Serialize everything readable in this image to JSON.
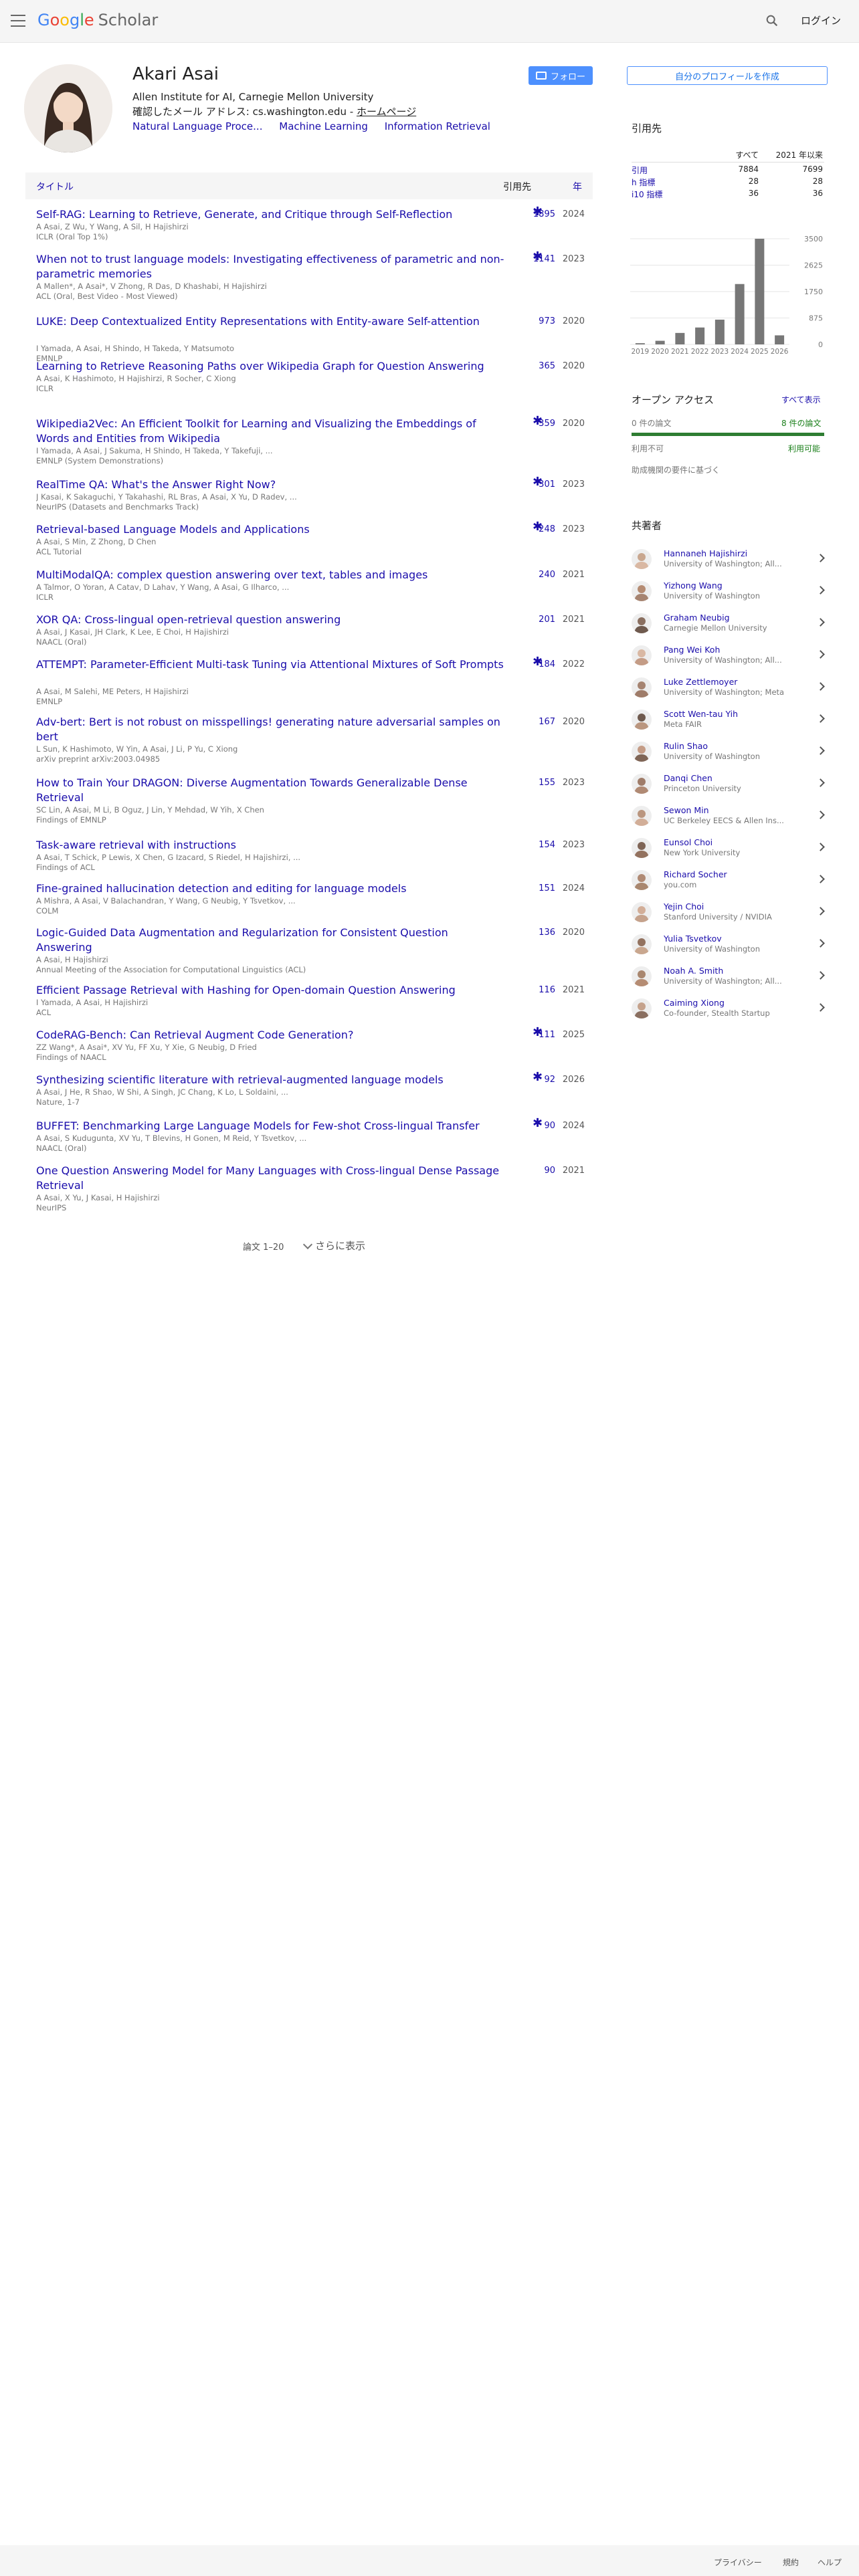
{
  "header": {
    "logo_google": [
      "G",
      "o",
      "o",
      "g",
      "l",
      "e"
    ],
    "logo_scholar": "Scholar",
    "login": "ログイン"
  },
  "profile": {
    "name": "Akari Asai",
    "affiliation": "Allen Institute for AI, Carnegie Mellon University",
    "email_text": "確認したメール アドレス: cs.washington.edu - ",
    "homepage": "ホームページ",
    "interests": [
      "Natural Language Proce...",
      "Machine Learning",
      "Information Retrieval"
    ],
    "follow": "フォロー"
  },
  "table": {
    "col_title": "タイトル",
    "col_cites": "引用先",
    "col_year": "年"
  },
  "publications": [
    {
      "title": "Self-RAG: Learning to Retrieve, Generate, and Critique through Self-Reflection",
      "authors": "A Asai, Z Wu, Y Wang, A Sil, H Hajishirzi",
      "venue": "ICLR (Oral Top 1%)",
      "cites": "1895",
      "star": true,
      "year": "2024"
    },
    {
      "title": "When not to trust language models: Investigating effectiveness of parametric and non-parametric memories",
      "authors": "A Mallen*, A Asai*, V Zhong, R Das, D Khashabi, H Hajishirzi",
      "venue": "ACL (Oral, Best Video - Most Viewed)",
      "cites": "1141",
      "star": true,
      "year": "2023"
    },
    {
      "title": "LUKE: Deep Contextualized Entity Representations with Entity-aware Self-attention",
      "authors": "I Yamada, A Asai, H Shindo, H Takeda, Y Matsumoto",
      "venue": "EMNLP",
      "cites": "973",
      "star": false,
      "year": "2020"
    },
    {
      "title": "Learning to Retrieve Reasoning Paths over Wikipedia Graph for Question Answering",
      "authors": "A Asai, K Hashimoto, H Hajishirzi, R Socher, C Xiong",
      "venue": "ICLR",
      "cites": "365",
      "star": false,
      "year": "2020"
    },
    {
      "title": "Wikipedia2Vec: An Efficient Toolkit for Learning and Visualizing the Embeddings of Words and Entities from Wikipedia",
      "authors": "I Yamada, A Asai, J Sakuma, H Shindo, H Takeda, Y Takefuji, ...",
      "venue": "EMNLP (System Demonstrations)",
      "cites": "359",
      "star": true,
      "year": "2020"
    },
    {
      "title": "RealTime QA: What's the Answer Right Now?",
      "authors": "J Kasai, K Sakaguchi, Y Takahashi, RL Bras, A Asai, X Yu, D Radev, ...",
      "venue": "NeurIPS (Datasets and Benchmarks Track)",
      "cites": "301",
      "star": true,
      "year": "2023"
    },
    {
      "title": "Retrieval-based Language Models and Applications",
      "authors": "A Asai, S Min, Z Zhong, D Chen",
      "venue": "ACL Tutorial",
      "cites": "248",
      "star": true,
      "year": "2023"
    },
    {
      "title": "MultiModalQA: complex question answering over text, tables and images",
      "authors": "A Talmor, O Yoran, A Catav, D Lahav, Y Wang, A Asai, G Ilharco, ...",
      "venue": "ICLR",
      "cites": "240",
      "star": false,
      "year": "2021"
    },
    {
      "title": "XOR QA: Cross-lingual open-retrieval question answering",
      "authors": "A Asai, J Kasai, JH Clark, K Lee, E Choi, H Hajishirzi",
      "venue": "NAACL (Oral)",
      "cites": "201",
      "star": false,
      "year": "2021"
    },
    {
      "title": "ATTEMPT: Parameter-Efficient Multi-task Tuning via Attentional Mixtures of Soft Prompts",
      "authors": "A Asai, M Salehi, ME Peters, H Hajishirzi",
      "venue": "EMNLP",
      "cites": "184",
      "star": true,
      "year": "2022"
    },
    {
      "title": "Adv-bert: Bert is not robust on misspellings! generating nature adversarial samples on bert",
      "authors": "L Sun, K Hashimoto, W Yin, A Asai, J Li, P Yu, C Xiong",
      "venue": "arXiv preprint arXiv:2003.04985",
      "cites": "167",
      "star": false,
      "year": "2020"
    },
    {
      "title": "How to Train Your DRAGON: Diverse Augmentation Towards Generalizable Dense Retrieval",
      "authors": "SC Lin, A Asai, M Li, B Oguz, J Lin, Y Mehdad, W Yih, X Chen",
      "venue": "Findings of EMNLP",
      "cites": "155",
      "star": false,
      "year": "2023"
    },
    {
      "title": "Task-aware retrieval with instructions",
      "authors": "A Asai, T Schick, P Lewis, X Chen, G Izacard, S Riedel, H Hajishirzi, ...",
      "venue": "Findings of ACL",
      "cites": "154",
      "star": false,
      "year": "2023"
    },
    {
      "title": "Fine-grained hallucination detection and editing for language models",
      "authors": "A Mishra, A Asai, V Balachandran, Y Wang, G Neubig, Y Tsvetkov, ...",
      "venue": "COLM",
      "cites": "151",
      "star": false,
      "year": "2024"
    },
    {
      "title": "Logic-Guided Data Augmentation and Regularization for Consistent Question Answering",
      "authors": "A Asai, H Hajishirzi",
      "venue": "Annual Meeting of the Association for Computational Linguistics (ACL)",
      "cites": "136",
      "star": false,
      "year": "2020"
    },
    {
      "title": "Efficient Passage Retrieval with Hashing for Open-domain Question Answering",
      "authors": "I Yamada, A Asai, H Hajishirzi",
      "venue": "ACL",
      "cites": "116",
      "star": false,
      "year": "2021"
    },
    {
      "title": "CodeRAG-Bench: Can Retrieval Augment Code Generation?",
      "authors": "ZZ Wang*, A Asai*, XV Yu, FF Xu, Y Xie, G Neubig, D Fried",
      "venue": "Findings of NAACL",
      "cites": "111",
      "star": true,
      "year": "2025"
    },
    {
      "title": "Synthesizing scientific literature with retrieval-augmented language models",
      "authors": "A Asai, J He, R Shao, W Shi, A Singh, JC Chang, K Lo, L Soldaini, ...",
      "venue": "Nature, 1-7",
      "cites": "92",
      "star": true,
      "year": "2026"
    },
    {
      "title": "BUFFET: Benchmarking Large Language Models for Few-shot Cross-lingual Transfer",
      "authors": "A Asai, S Kudugunta, XV Yu, T Blevins, H Gonen, M Reid, Y Tsvetkov, ...",
      "venue": "NAACL (Oral)",
      "cites": "90",
      "star": true,
      "year": "2024"
    },
    {
      "title": "One Question Answering Model for Many Languages with Cross-lingual Dense Passage Retrieval",
      "authors": "A Asai, X Yu, J Kasai, H Hajishirzi",
      "venue": "NeurIPS",
      "cites": "90",
      "star": false,
      "year": "2021"
    }
  ],
  "pagination": {
    "range": "論文 1–20",
    "show_more": "さらに表示"
  },
  "sidebar": {
    "create_profile": "自分のプロフィールを作成",
    "cited_by": "引用先",
    "col_all": "すべて",
    "col_since": "2021 年以来",
    "metrics": [
      {
        "label": "引用",
        "all": "7884",
        "since": "7699"
      },
      {
        "label": "h 指標",
        "all": "28",
        "since": "28"
      },
      {
        "label": "i10 指標",
        "all": "36",
        "since": "36"
      }
    ],
    "open_access_title": "オープン アクセス",
    "show_all": "すべて表示",
    "oa_left": "0 件の論文",
    "oa_right": "8 件の論文",
    "not_available": "利用不可",
    "available": "利用可能",
    "mandate_note": "助成機関の要件に基づく",
    "coauthors_title": "共著者"
  },
  "chart_data": {
    "type": "bar",
    "categories": [
      "2019",
      "2020",
      "2021",
      "2022",
      "2023",
      "2024",
      "2025",
      "2026"
    ],
    "values": [
      40,
      120,
      380,
      560,
      820,
      2000,
      3500,
      300
    ],
    "yticks": [
      "3500",
      "2625",
      "1750",
      "875",
      "0"
    ],
    "ylim": [
      0,
      3500
    ],
    "bar_color": "#777777"
  },
  "coauthors": [
    {
      "name": "Hannaneh Hajishirzi",
      "affiliation": "University of Washington; All..."
    },
    {
      "name": "Yizhong Wang",
      "affiliation": "University of Washington"
    },
    {
      "name": "Graham Neubig",
      "affiliation": "Carnegie Mellon University"
    },
    {
      "name": "Pang Wei Koh",
      "affiliation": "University of Washington; All..."
    },
    {
      "name": "Luke Zettlemoyer",
      "affiliation": "University of Washington; Meta"
    },
    {
      "name": "Scott Wen-tau Yih",
      "affiliation": "Meta FAIR"
    },
    {
      "name": "Rulin Shao",
      "affiliation": "University of Washington"
    },
    {
      "name": "Danqi Chen",
      "affiliation": "Princeton University"
    },
    {
      "name": "Sewon Min",
      "affiliation": "UC Berkeley EECS & Allen Ins..."
    },
    {
      "name": "Eunsol Choi",
      "affiliation": "New York University"
    },
    {
      "name": "Richard Socher",
      "affiliation": "you.com"
    },
    {
      "name": "Yejin Choi",
      "affiliation": "Stanford University / NVIDIA"
    },
    {
      "name": "Yulia Tsvetkov",
      "affiliation": "University of Washington"
    },
    {
      "name": "Noah A. Smith",
      "affiliation": "University of Washington; All..."
    },
    {
      "name": "Caiming Xiong",
      "affiliation": "Co-founder, Stealth Startup"
    }
  ],
  "footer": {
    "privacy": "プライバシー",
    "terms": "規約",
    "help": "ヘルプ"
  }
}
